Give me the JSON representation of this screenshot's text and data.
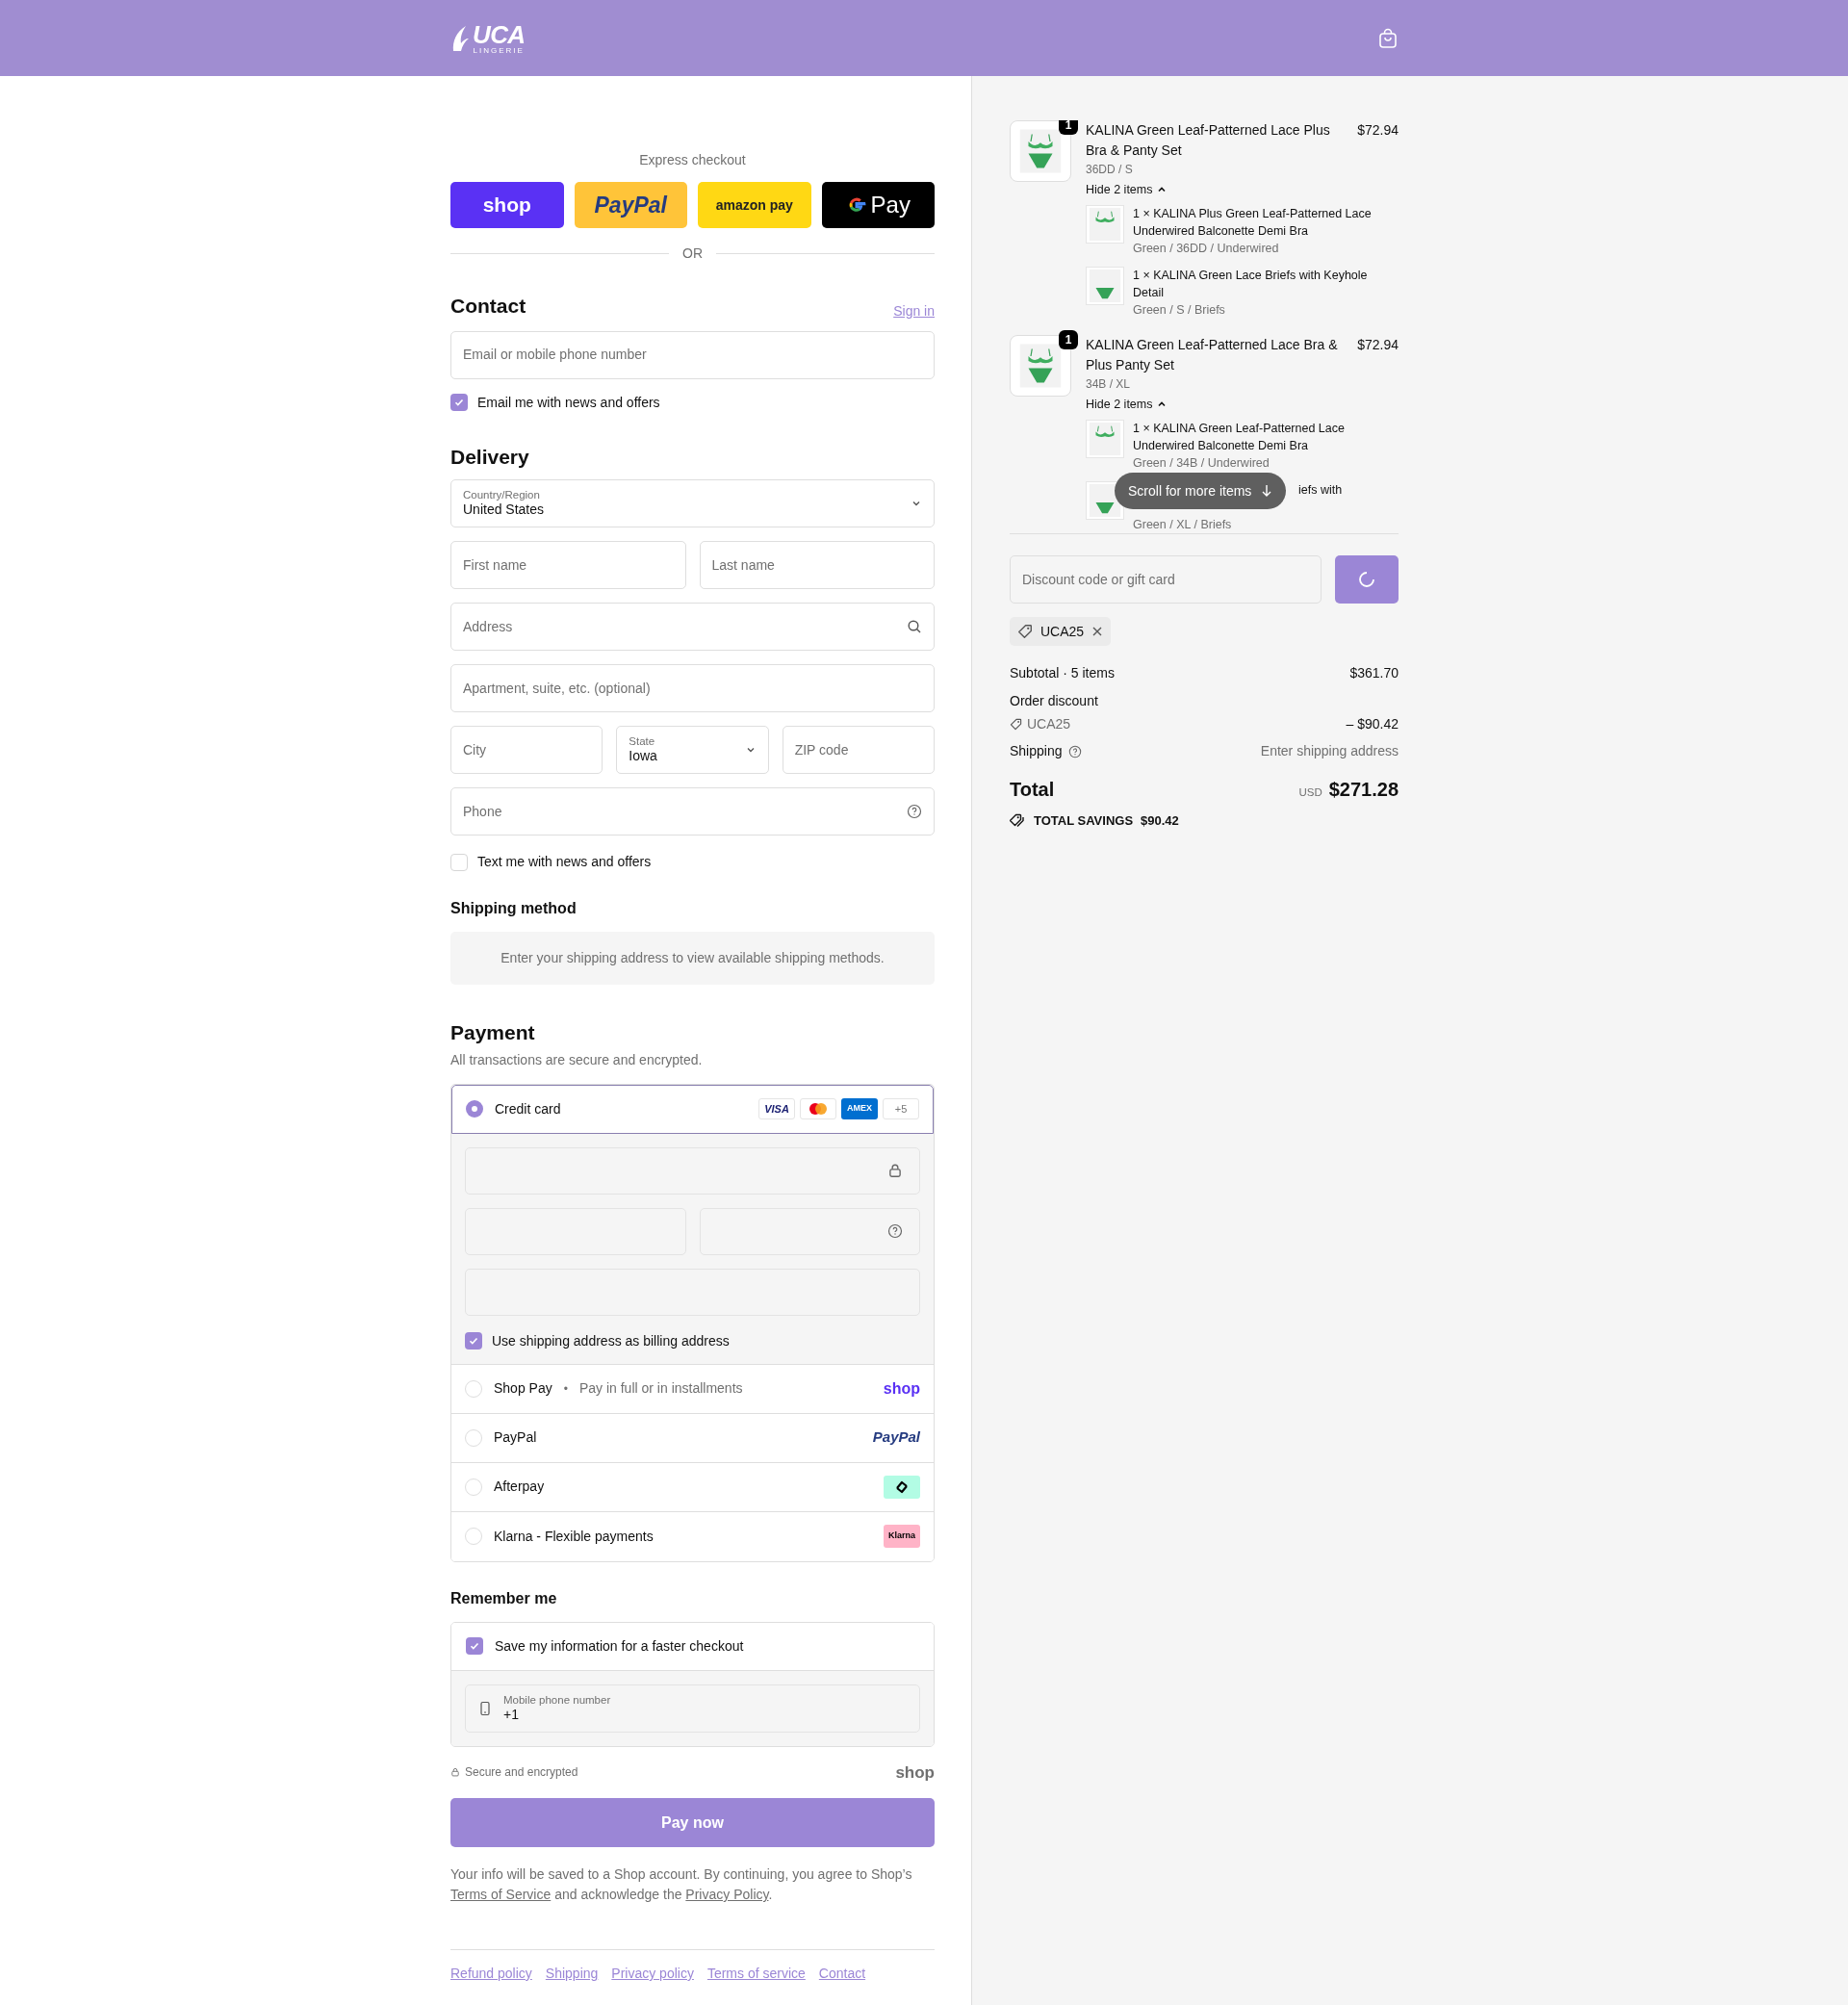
{
  "header": {
    "logo": "UCA",
    "logo_sub": "LINGERIE"
  },
  "express": {
    "title": "Express checkout",
    "divider": "OR",
    "buttons": [
      {
        "kind": "shop",
        "label": "shop"
      },
      {
        "kind": "paypal",
        "label": "PayPal"
      },
      {
        "kind": "amazon",
        "label": "amazon pay"
      },
      {
        "kind": "gpay",
        "label": "Pay"
      }
    ]
  },
  "contact": {
    "heading": "Contact",
    "sign_in": "Sign in",
    "email_placeholder": "Email or mobile phone number",
    "newsletter": {
      "label": "Email me with news and offers",
      "checked": true
    }
  },
  "delivery": {
    "heading": "Delivery",
    "country": {
      "label": "Country/Region",
      "value": "United States"
    },
    "first_name_placeholder": "First name",
    "last_name_placeholder": "Last name",
    "address_placeholder": "Address",
    "apartment_placeholder": "Apartment, suite, etc. (optional)",
    "city_placeholder": "City",
    "state": {
      "label": "State",
      "value": "Iowa"
    },
    "zip_placeholder": "ZIP code",
    "phone_placeholder": "Phone",
    "sms": {
      "label": "Text me with news and offers",
      "checked": false
    }
  },
  "shipping_method": {
    "heading": "Shipping method",
    "message": "Enter your shipping address to view available shipping methods."
  },
  "payment": {
    "heading": "Payment",
    "subtitle": "All transactions are secure and encrypted.",
    "billing": {
      "label": "Use shipping address as billing address",
      "checked": true
    },
    "methods": [
      {
        "kind": "card",
        "label": "Credit card",
        "selected": true,
        "brands": [
          {
            "kind": "visa",
            "label": "VISA"
          },
          {
            "kind": "mastercard"
          },
          {
            "kind": "amex",
            "label": "AMEX"
          },
          {
            "kind": "more",
            "label": "+5"
          }
        ]
      },
      {
        "kind": "shoppay",
        "label": "Shop Pay",
        "separator": "•",
        "note": "Pay in full or in installments",
        "logo": "shop",
        "selected": false
      },
      {
        "kind": "paypal",
        "label": "PayPal",
        "logo": "PayPal",
        "selected": false
      },
      {
        "kind": "afterpay",
        "label": "Afterpay",
        "selected": false
      },
      {
        "kind": "klarna",
        "label": "Klarna - Flexible payments",
        "logo": "Klarna",
        "selected": false
      }
    ]
  },
  "remember": {
    "heading": "Remember me",
    "save": {
      "label": "Save my information for a faster checkout",
      "checked": true
    },
    "phone": {
      "label": "Mobile phone number",
      "value": "+1"
    }
  },
  "secure": {
    "label": "Secure and encrypted",
    "logo": "shop"
  },
  "pay_button": "Pay now",
  "legal": {
    "text": "Your info will be saved to a Shop account. By continuing, you agree to Shop’s",
    "terms": "Terms of Service",
    "middle": "and acknowledge the",
    "privacy": "Privacy Policy",
    "end": "."
  },
  "footer_links": [
    "Refund policy",
    "Shipping",
    "Privacy policy",
    "Terms of service",
    "Contact"
  ],
  "order": {
    "items": [
      {
        "quantity": "1",
        "title": "KALINA Green Leaf-Patterned Lace Plus Bra & Panty Set",
        "variant": "36DD / S",
        "price": "$72.94",
        "toggle": "Hide 2 items",
        "expanded": true,
        "children": [
          {
            "kind": "bra",
            "title": "1 × KALINA Plus Green Leaf-Patterned Lace Underwired Balconette Demi Bra",
            "variant": "Green / 36DD / Underwired",
            "partially_hidden": false
          },
          {
            "kind": "briefs",
            "title": "1 × KALINA Green Lace Briefs with Keyhole Detail",
            "variant": "Green / S / Briefs",
            "partially_hidden": false
          }
        ]
      },
      {
        "quantity": "1",
        "title": "KALINA Green Leaf-Patterned Lace Bra & Plus Panty Set",
        "variant": "34B / XL",
        "price": "$72.94",
        "toggle": "Hide 2 items",
        "expanded": true,
        "children": [
          {
            "kind": "bra",
            "title": "1 × KALINA Green Leaf-Patterned Lace Underwired Balconette Demi Bra",
            "variant": "Green / 34B / Underwired",
            "partially_hidden": false
          },
          {
            "kind": "briefs",
            "title": "iefs with",
            "variant": "Green / XL / Briefs",
            "partially_hidden": true
          }
        ]
      }
    ],
    "scroll_hint": "Scroll for more items"
  },
  "discount": {
    "placeholder": "Discount code or gift card",
    "applied_code": "UCA25"
  },
  "summary": {
    "subtotal_label": "Subtotal · 5 items",
    "subtotal": "$361.70",
    "discount_label": "Order discount",
    "discount_code": "UCA25",
    "discount_amount": "– $90.42",
    "shipping_label": "Shipping",
    "shipping_value": "Enter shipping address",
    "total_label": "Total",
    "currency": "USD",
    "total": "$271.28",
    "savings_label": "TOTAL SAVINGS",
    "savings": "$90.42"
  }
}
